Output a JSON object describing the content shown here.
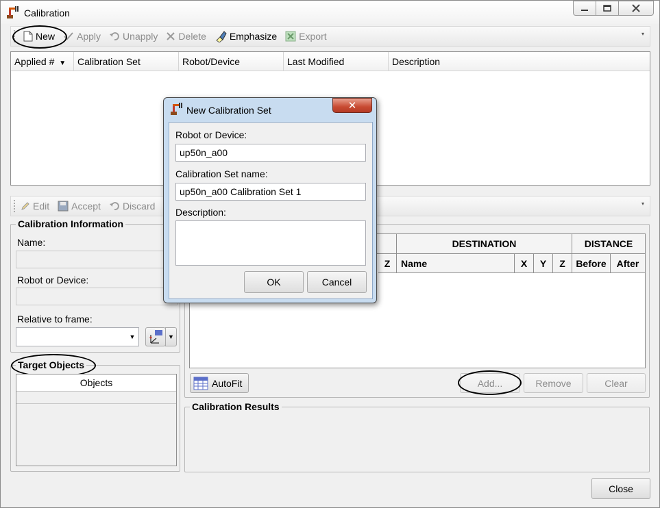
{
  "window": {
    "title": "Calibration"
  },
  "toolbar1": {
    "new": "New",
    "apply": "Apply",
    "unapply": "Unapply",
    "delete": "Delete",
    "emphasize": "Emphasize",
    "export": "Export"
  },
  "sets_table": {
    "columns": [
      "Applied #",
      "Calibration Set",
      "Robot/Device",
      "Last Modified",
      "Description"
    ]
  },
  "toolbar2": {
    "edit": "Edit",
    "accept": "Accept",
    "discard": "Discard"
  },
  "info": {
    "title": "Calibration Information",
    "name_label": "Name:",
    "robot_label": "Robot or Device:",
    "frame_label": "Relative to frame:"
  },
  "targets": {
    "title": "Target Objects",
    "objects_header": "Objects"
  },
  "points_table": {
    "destination": "DESTINATION",
    "distance": "DISTANCE",
    "z_source": "Z",
    "name": "Name",
    "x": "X",
    "y": "Y",
    "z": "Z",
    "before": "Before",
    "after": "After"
  },
  "actions": {
    "autofit": "AutoFit",
    "add": "Add...",
    "remove": "Remove",
    "clear": "Clear"
  },
  "results": {
    "title": "Calibration Results"
  },
  "close": "Close",
  "dialog": {
    "title": "New Calibration Set",
    "robot_label": "Robot or Device:",
    "robot_value": "up50n_a00",
    "name_label": "Calibration Set name:",
    "name_value": "up50n_a00 Calibration Set 1",
    "desc_label": "Description:",
    "desc_value": "",
    "ok": "OK",
    "cancel": "Cancel"
  }
}
